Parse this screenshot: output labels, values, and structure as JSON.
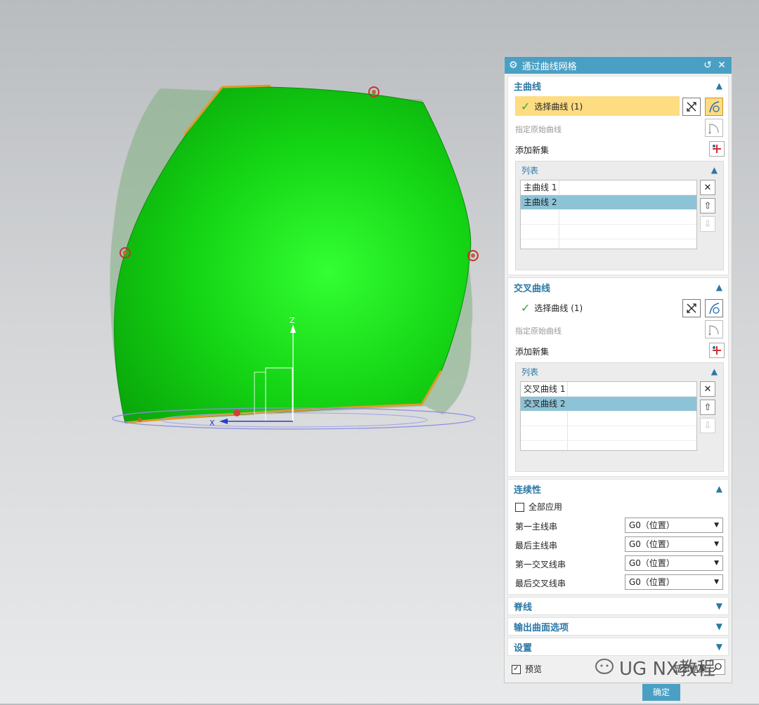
{
  "dialog": {
    "title": "通过曲线网格",
    "primary": {
      "header": "主曲线",
      "select_label": "选择曲线 (1)",
      "specify_original": "指定原始曲线",
      "add_new_set": "添加新集",
      "list_header": "列表",
      "items": [
        "主曲线 1",
        "主曲线 2"
      ]
    },
    "cross": {
      "header": "交叉曲线",
      "select_label": "选择曲线 (1)",
      "specify_original": "指定原始曲线",
      "add_new_set": "添加新集",
      "list_header": "列表",
      "items": [
        "交叉曲线 1",
        "交叉曲线 2"
      ]
    },
    "continuity": {
      "header": "连续性",
      "apply_all": "全部应用",
      "rows": [
        {
          "label": "第一主线串",
          "value": "G0（位置）"
        },
        {
          "label": "最后主线串",
          "value": "G0（位置）"
        },
        {
          "label": "第一交叉线串",
          "value": "G0（位置）"
        },
        {
          "label": "最后交叉线串",
          "value": "G0（位置）"
        }
      ]
    },
    "collapsed": {
      "spine": "脊线",
      "output": "输出曲面选项",
      "settings": "设置"
    },
    "preview_label": "预览",
    "show_result": "显示结果",
    "ok_label": "确定"
  },
  "viewport": {
    "axis_z": "Z",
    "axis_x": "X"
  },
  "watermark": "UG NX教程",
  "colors": {
    "title_bar": "#4aa0c4",
    "surface_green": "#1fdc1f",
    "highlight": "#fddc82",
    "selected_row": "#8cc3d7"
  }
}
